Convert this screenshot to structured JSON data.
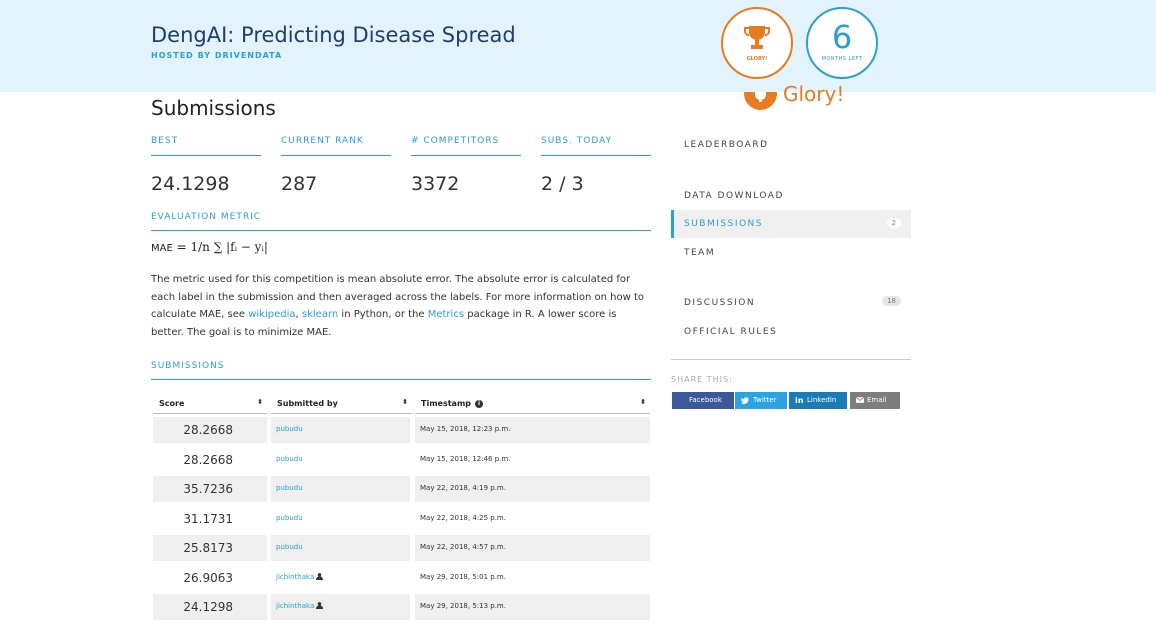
{
  "header": {
    "title": "DengAI: Predicting Disease Spread",
    "hosted_by": "HOSTED BY DRIVENDATA",
    "prize_caption": "GLORY!",
    "months_left_value": "6",
    "months_left_caption": "MONTHS LEFT",
    "prize_text": "Glory!",
    "colors": {
      "prize": "#e87b1e",
      "accent": "#2a9fd6",
      "header_bg": "#e3f3fb"
    }
  },
  "main": {
    "title": "Submissions",
    "stats": [
      {
        "label": "BEST",
        "value": "24.1298"
      },
      {
        "label": "CURRENT RANK",
        "value": "287"
      },
      {
        "label": "# COMPETITORS",
        "value": "3372"
      },
      {
        "label": "SUBS. TODAY",
        "value": "2 / 3"
      }
    ],
    "metric": {
      "heading": "EVALUATION METRIC",
      "formula_lhs": "MAE",
      "formula_rhs": "= 1/n ∑ |fᵢ − yᵢ|",
      "desc_1": "The metric used for this competition is mean absolute error. The absolute error is calculated for each label in the submission and then averaged across the labels. For more information on how to calculate MAE, see ",
      "link_wikipedia": "wikipedia",
      "desc_2": ", ",
      "link_sklearn": "sklearn",
      "desc_3": " in Python, or the ",
      "link_metrics": "Metrics",
      "desc_4": " package in R. A lower score is better. The goal is to minimize MAE."
    },
    "submissions": {
      "heading": "SUBMISSIONS",
      "columns": {
        "score": "Score",
        "submitted_by": "Submitted by",
        "timestamp": "Timestamp"
      },
      "rows": [
        {
          "score": "28.2668",
          "user": "pubudu",
          "time": "May 15, 2018, 12:23 p.m."
        },
        {
          "score": "28.2668",
          "user": "pubudu",
          "time": "May 15, 2018, 12:46 p.m."
        },
        {
          "score": "35.7236",
          "user": "pubudu",
          "time": "May 22, 2018, 4:19 p.m."
        },
        {
          "score": "31.1731",
          "user": "pubudu",
          "time": "May 22, 2018, 4:25 p.m."
        },
        {
          "score": "25.8173",
          "user": "pubudu",
          "time": "May 22, 2018, 4:57 p.m."
        },
        {
          "score": "26.9063",
          "user": "jichinthaka",
          "time": "May 29, 2018, 5:01 p.m."
        },
        {
          "score": "24.1298",
          "user": "jichinthaka",
          "time": "May 29, 2018, 5:13 p.m."
        }
      ]
    }
  },
  "sidebar": {
    "items": [
      {
        "label": "LEADERBOARD"
      },
      {
        "label": "DATA DOWNLOAD"
      },
      {
        "label": "SUBMISSIONS",
        "badge": "2"
      },
      {
        "label": "TEAM"
      },
      {
        "label": "DISCUSSION",
        "badge": "18"
      },
      {
        "label": "OFFICIAL RULES"
      }
    ],
    "share_label": "SHARE THIS:",
    "share": [
      {
        "label": "Facebook",
        "color": "#3b5998"
      },
      {
        "label": "Twitter",
        "color": "#2aa3e0"
      },
      {
        "label": "LinkedIn",
        "color": "#1a7bb5"
      },
      {
        "label": "Email",
        "color": "#7d7d7d"
      }
    ]
  }
}
